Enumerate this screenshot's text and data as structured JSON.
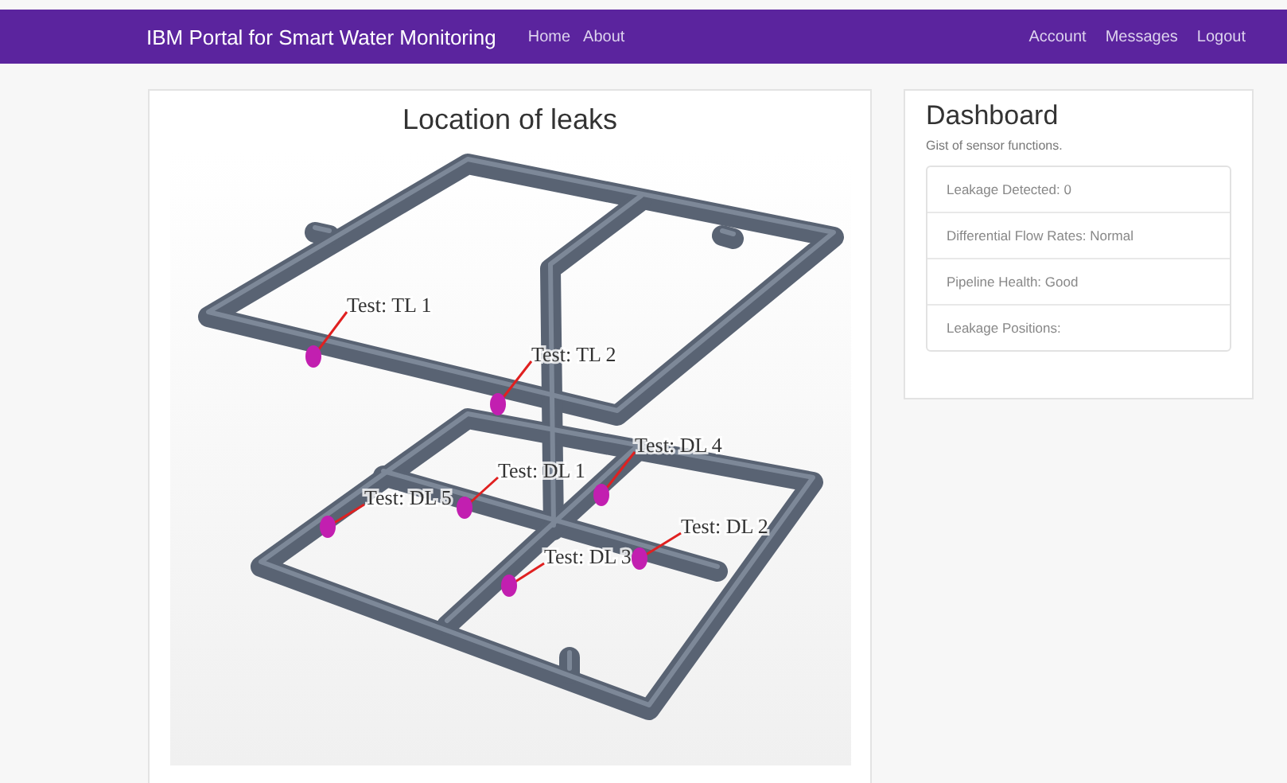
{
  "navbar": {
    "brand": "IBM Portal for Smart Water Monitoring",
    "left_links": [
      "Home",
      "About"
    ],
    "right_links": [
      "Account",
      "Messages",
      "Logout"
    ]
  },
  "leak_map": {
    "title": "Location of leaks",
    "leaks": [
      {
        "label": "Test: TL 1"
      },
      {
        "label": "Test: TL 2"
      },
      {
        "label": "Test: DL 4"
      },
      {
        "label": "Test: DL 1"
      },
      {
        "label": "Test: DL 5"
      },
      {
        "label": "Test: DL 3"
      },
      {
        "label": "Test: DL 2"
      }
    ]
  },
  "dashboard": {
    "title": "Dashboard",
    "subtitle": "Gist of sensor functions.",
    "items": [
      "Leakage Detected: 0",
      "Differential Flow Rates: Normal",
      "Pipeline Health: Good",
      "Leakage Positions:"
    ]
  }
}
